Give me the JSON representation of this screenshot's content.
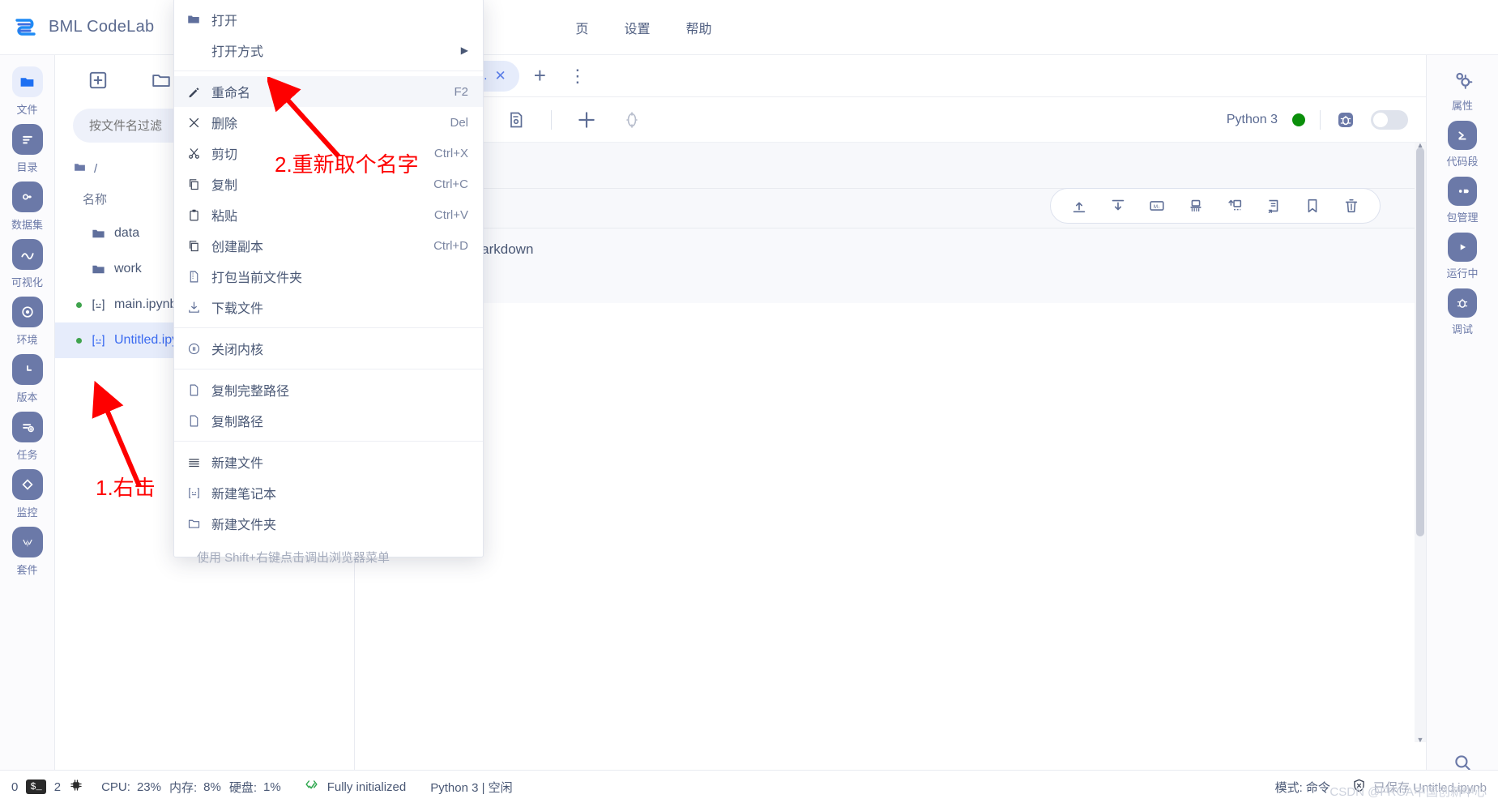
{
  "app": {
    "brand": "BML CodeLab",
    "logo_color": "#2a7cf7"
  },
  "menubar": [
    {
      "label": "页"
    },
    {
      "label": "设置"
    },
    {
      "label": "帮助"
    }
  ],
  "left_rail": [
    {
      "icon": "folder-icon",
      "label": "文件",
      "active": true
    },
    {
      "icon": "list-icon",
      "label": "目录",
      "active": false
    },
    {
      "icon": "dataset-icon",
      "label": "数据集",
      "active": false
    },
    {
      "icon": "chart-icon",
      "label": "可视化",
      "active": false
    },
    {
      "icon": "environment-icon",
      "label": "环境",
      "active": false
    },
    {
      "icon": "version-icon",
      "label": "版本",
      "active": false
    },
    {
      "icon": "task-icon",
      "label": "任务",
      "active": false
    },
    {
      "icon": "monitor-icon",
      "label": "监控",
      "active": false
    },
    {
      "icon": "kit-icon",
      "label": "套件",
      "active": false
    }
  ],
  "file_panel": {
    "toolbar": [
      {
        "icon": "new-launcher-icon"
      },
      {
        "icon": "new-folder-icon"
      }
    ],
    "filter_placeholder": "按文件名过滤",
    "filter_value": "",
    "breadcrumb": "/",
    "column_header": "名称",
    "items": [
      {
        "name": "data",
        "type": "folder",
        "running": false,
        "selected": false
      },
      {
        "name": "work",
        "type": "folder",
        "running": false,
        "selected": false
      },
      {
        "name": "main.ipynb",
        "type": "notebook",
        "running": true,
        "selected": false
      },
      {
        "name": "Untitled.ipynb",
        "type": "notebook",
        "running": true,
        "selected": true
      }
    ]
  },
  "context_menu": {
    "items": [
      {
        "label": "打开",
        "icon": "folder-icon",
        "shortcut": "",
        "submenu": false,
        "highlight": false
      },
      {
        "label": "打开方式",
        "icon": "",
        "shortcut": "",
        "submenu": true,
        "highlight": false
      },
      {
        "separator": true
      },
      {
        "label": "重命名",
        "icon": "pencil-icon",
        "shortcut": "F2",
        "submenu": false,
        "highlight": true
      },
      {
        "label": "删除",
        "icon": "close-x-icon",
        "shortcut": "Del",
        "submenu": false,
        "highlight": false
      },
      {
        "label": "剪切",
        "icon": "scissors-icon",
        "shortcut": "Ctrl+X",
        "submenu": false,
        "highlight": false
      },
      {
        "label": "复制",
        "icon": "copy-icon",
        "shortcut": "Ctrl+C",
        "submenu": false,
        "highlight": false
      },
      {
        "label": "粘贴",
        "icon": "clipboard-icon",
        "shortcut": "Ctrl+V",
        "submenu": false,
        "highlight": false
      },
      {
        "label": "创建副本",
        "icon": "duplicate-icon",
        "shortcut": "Ctrl+D",
        "submenu": false,
        "highlight": false
      },
      {
        "label": "打包当前文件夹",
        "icon": "zip-icon",
        "shortcut": "",
        "submenu": false,
        "highlight": false
      },
      {
        "label": "下载文件",
        "icon": "download-icon",
        "shortcut": "",
        "submenu": false,
        "highlight": false
      },
      {
        "separator": true
      },
      {
        "label": "关闭内核",
        "icon": "shutdown-icon",
        "shortcut": "",
        "submenu": false,
        "highlight": false
      },
      {
        "separator": true
      },
      {
        "label": "复制完整路径",
        "icon": "file-icon",
        "shortcut": "",
        "submenu": false,
        "highlight": false
      },
      {
        "label": "复制路径",
        "icon": "file-icon",
        "shortcut": "",
        "submenu": false,
        "highlight": false
      },
      {
        "separator": true
      },
      {
        "label": "新建文件",
        "icon": "new-file-icon",
        "shortcut": "",
        "submenu": false,
        "highlight": false
      },
      {
        "label": "新建笔记本",
        "icon": "notebook-icon",
        "shortcut": "",
        "submenu": false,
        "highlight": false
      },
      {
        "label": "新建文件夹",
        "icon": "new-folder-icon",
        "shortcut": "",
        "submenu": false,
        "highlight": false
      }
    ],
    "hint": "使用 Shift+右键点击调出浏览器菜单"
  },
  "tabs": {
    "items": [
      {
        "label": "Untitled.ip...",
        "icon": "notebook-icon",
        "active": true
      }
    ],
    "add_label": "+",
    "more_label": "⋮"
  },
  "notebook_toolbar": {
    "icons": [
      "run-icon",
      "restart-icon",
      "interrupt-icon",
      "save-snapshot-icon",
      "add-cell-icon",
      "settings-ring-icon"
    ],
    "kernel_name": "Python 3",
    "kernel_status_color": "#0a8f0a",
    "debug_icon": "bug-icon",
    "toggle_state": "off"
  },
  "cell_toolbar": {
    "icons": [
      "move-cell-up-icon",
      "move-cell-down-icon",
      "markdown-cell-icon",
      "clear-output-icon",
      "insert-cell-above-icon",
      "run-and-advance-icon",
      "bookmark-icon",
      "delete-cell-icon"
    ]
  },
  "notebook_body": {
    "cell_type_label": "Markdown"
  },
  "right_rail": [
    {
      "icon": "gears-icon",
      "label": "属性"
    },
    {
      "icon": "snippet-icon",
      "label": "代码段"
    },
    {
      "icon": "package-icon",
      "label": "包管理"
    },
    {
      "icon": "running-icon",
      "label": "运行中"
    },
    {
      "icon": "bug-icon",
      "label": "调试"
    }
  ],
  "right_rail_bottom": {
    "icon": "search-icon"
  },
  "status_bar": {
    "terminals_count": "0",
    "terminal_chip": "$_",
    "kernels_count": "2",
    "cpu_icon": "cpu-icon",
    "cpu_label": "CPU:",
    "cpu_value": "23%",
    "mem_label": "内存:",
    "mem_value": "8%",
    "disk_label": "硬盘:",
    "disk_value": "1%",
    "init_icon": "code-check-icon",
    "init_text": "Fully initialized",
    "kernel_text": "Python 3 | 空闲",
    "mode_text": "模式: 命令",
    "saved_icon": "shield-x-icon",
    "saved_text": "已保存 Untitled.ipynb"
  },
  "annotations": [
    {
      "id": "annot-1",
      "text": "1.右击"
    },
    {
      "id": "annot-2",
      "text": "2.重新取个名字"
    }
  ],
  "watermark": {
    "text": "CSDN @FRGA中国创新中心"
  }
}
